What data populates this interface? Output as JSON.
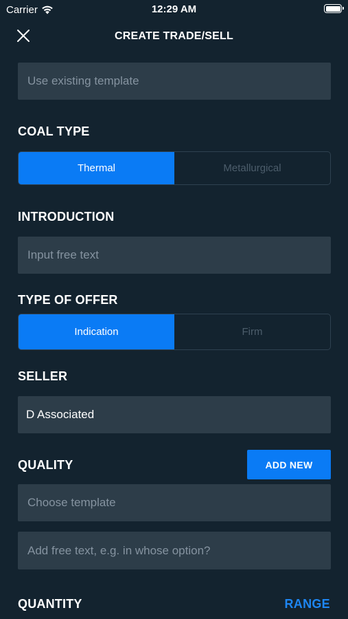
{
  "status_bar": {
    "carrier": "Carrier",
    "time": "12:29 AM"
  },
  "header": {
    "title": "CREATE TRADE/SELL"
  },
  "template": {
    "placeholder": "Use existing template"
  },
  "coal_type": {
    "label": "COAL TYPE",
    "options": [
      "Thermal",
      "Metallurgical"
    ],
    "selected": "Thermal"
  },
  "introduction": {
    "label": "INTRODUCTION",
    "placeholder": "Input free text"
  },
  "type_of_offer": {
    "label": "TYPE OF OFFER",
    "options": [
      "Indication",
      "Firm"
    ],
    "selected": "Indication"
  },
  "seller": {
    "label": "SELLER",
    "value": "D Associated"
  },
  "quality": {
    "label": "QUALITY",
    "add_new_label": "ADD NEW",
    "template_placeholder": "Choose template",
    "free_text_placeholder": "Add free text, e.g. in whose option?"
  },
  "quantity": {
    "label": "QUANTITY",
    "range_label": "RANGE"
  },
  "colors": {
    "background": "#13232f",
    "field": "#2d3d49",
    "accent": "#0a7bf5",
    "link": "#1e86f2"
  }
}
